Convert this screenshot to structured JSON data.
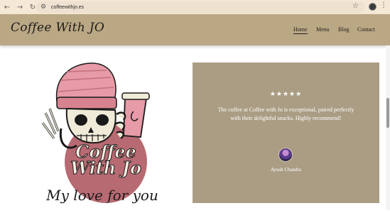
{
  "browser": {
    "url": "coffeewithjo.es",
    "back_icon": "←",
    "forward_icon": "→",
    "reload_icon": "↻",
    "tune_icon": "⚙",
    "star_icon": "☆",
    "menu_icon": "⋮"
  },
  "header": {
    "logo": "Coffee With JO",
    "nav": [
      {
        "label": "Home",
        "active": true
      },
      {
        "label": "Menu",
        "active": false
      },
      {
        "label": "Blog",
        "active": false
      },
      {
        "label": "Contact",
        "active": false
      }
    ],
    "background": "#baa783"
  },
  "hero": {
    "badge_line1": "Coffee",
    "badge_line2": "With Jo",
    "tagline": "My love for you"
  },
  "testimonial": {
    "stars": "★★★★★",
    "quote": "The coffee at Coffee with Jo is exceptional, paired perfectly with their delightful snacks. Highly recommend!",
    "author": "Ayush Chandra",
    "background": "#ab9d84"
  }
}
